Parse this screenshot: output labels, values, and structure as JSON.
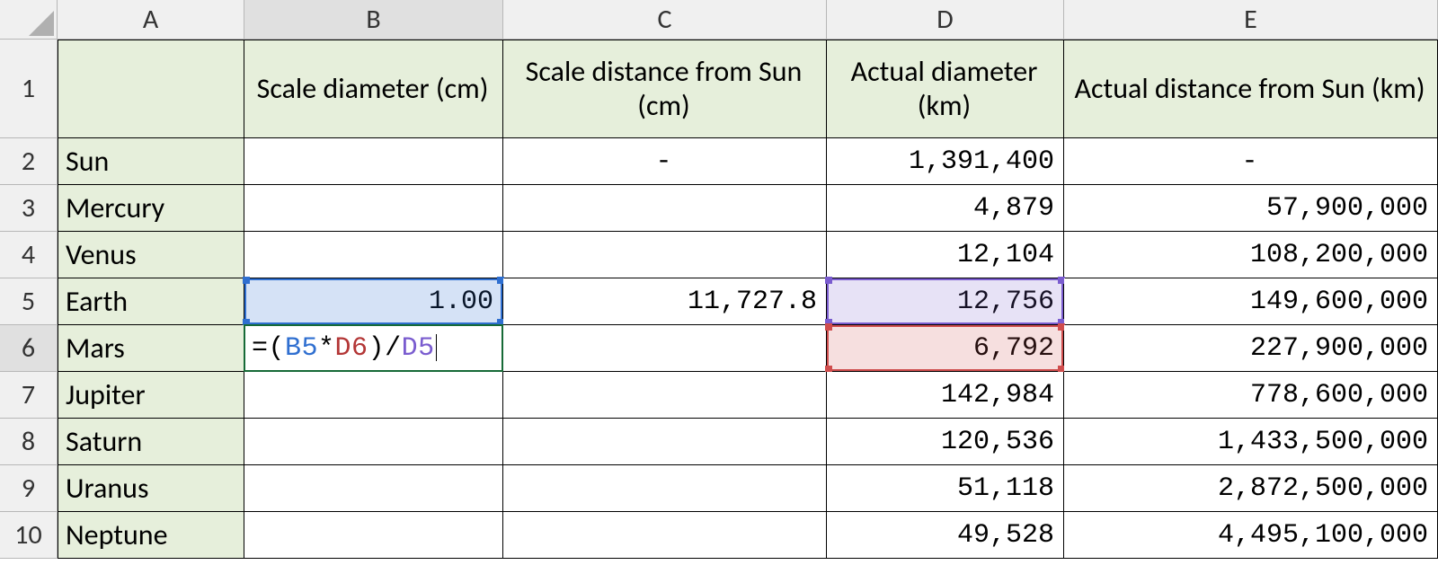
{
  "columns": [
    "A",
    "B",
    "C",
    "D",
    "E"
  ],
  "row_numbers": [
    1,
    2,
    3,
    4,
    5,
    6,
    7,
    8,
    9,
    10
  ],
  "active_column": "B",
  "active_row": 6,
  "editing_cell": "B6",
  "headers": {
    "A": "",
    "B": "Scale diameter (cm)",
    "C": "Scale distance from Sun (cm)",
    "D": "Actual diameter (km)",
    "E": "Actual distance from Sun (km)"
  },
  "row_labels": {
    "2": "Sun",
    "3": "Mercury",
    "4": "Venus",
    "5": "Earth",
    "6": "Mars",
    "7": "Jupiter",
    "8": "Saturn",
    "9": "Uranus",
    "10": "Neptune"
  },
  "cells": {
    "B5": "1.00",
    "C2": "-",
    "C5": "11,727.8",
    "D2": "1,391,400",
    "D3": "4,879",
    "D4": "12,104",
    "D5": "12,756",
    "D6": "6,792",
    "D7": "142,984",
    "D8": "120,536",
    "D9": "51,118",
    "D10": "49,528",
    "E2": "-",
    "E3": "57,900,000",
    "E4": "108,200,000",
    "E5": "149,600,000",
    "E6": "227,900,000",
    "E7": "778,600,000",
    "E8": "1,433,500,000",
    "E9": "2,872,500,000",
    "E10": "4,495,100,000"
  },
  "formula": {
    "cell": "B6",
    "raw": "=(B5*D6)/D5",
    "tokens": [
      {
        "text": "=(",
        "cls": ""
      },
      {
        "text": "B5",
        "cls": "f-b"
      },
      {
        "text": "*",
        "cls": ""
      },
      {
        "text": "D6",
        "cls": "f-d6"
      },
      {
        "text": ")/",
        "cls": ""
      },
      {
        "text": "D5",
        "cls": "f-d5"
      }
    ],
    "references": [
      {
        "cell": "B5",
        "color": "blue"
      },
      {
        "cell": "D5",
        "color": "purple"
      },
      {
        "cell": "D6",
        "color": "red"
      }
    ]
  },
  "chart_data": {
    "type": "table",
    "columns": [
      "",
      "Scale diameter (cm)",
      "Scale distance from Sun (cm)",
      "Actual diameter (km)",
      "Actual distance from Sun (km)"
    ],
    "rows": [
      [
        "Sun",
        null,
        null,
        1391400,
        null
      ],
      [
        "Mercury",
        null,
        null,
        4879,
        57900000
      ],
      [
        "Venus",
        null,
        null,
        12104,
        108200000
      ],
      [
        "Earth",
        1.0,
        11727.8,
        12756,
        149600000
      ],
      [
        "Mars",
        null,
        null,
        6792,
        227900000
      ],
      [
        "Jupiter",
        null,
        null,
        142984,
        778600000
      ],
      [
        "Saturn",
        null,
        null,
        120536,
        1433500000
      ],
      [
        "Uranus",
        null,
        null,
        51118,
        2872500000
      ],
      [
        "Neptune",
        null,
        null,
        49528,
        4495100000
      ]
    ],
    "title": "",
    "notes": "B6 is being edited with formula =(B5*D6)/D5"
  }
}
